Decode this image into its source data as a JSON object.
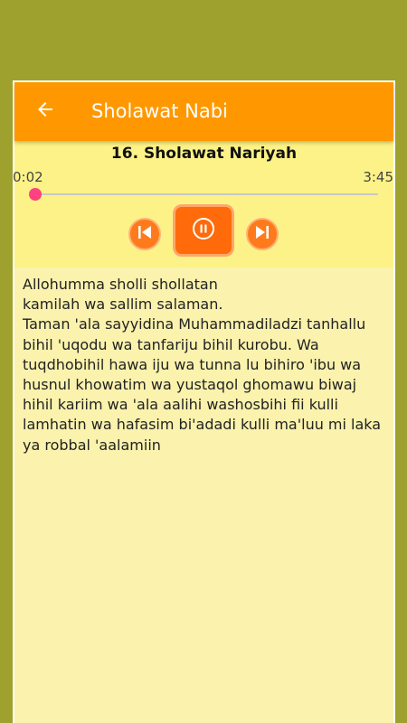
{
  "app_bar": {
    "title": "Sholawat Nabi",
    "back_icon": "arrow-back-icon",
    "color": "#ff9800"
  },
  "player": {
    "track_title": "16. Sholawat Nariyah",
    "current_time": "0:02",
    "total_time": "3:45",
    "progress_fraction": 0.009,
    "accent_color": "#ff4081",
    "controls": {
      "previous_icon": "skip-previous-icon",
      "play_pause_icon": "pause-icon",
      "next_icon": "skip-next-icon"
    }
  },
  "lyrics": {
    "text": "Allohumma sholli shollatan\nkamilah wa sallim salaman.\nTaman 'ala sayyidina Muhammadiladzi tanhallu bihil 'uqodu wa tanfariju bihil kurobu. Wa tuqdhobihil hawa iju wa tunna lu bihiro 'ibu wa husnul khowatim wa yustaqol ghomawu biwaj hihil kariim wa 'ala aalihi washosbihi fii kulli lamhatin wa hafasim bi'adadi kulli ma'luu mi laka ya robbal 'aalamiin"
  }
}
